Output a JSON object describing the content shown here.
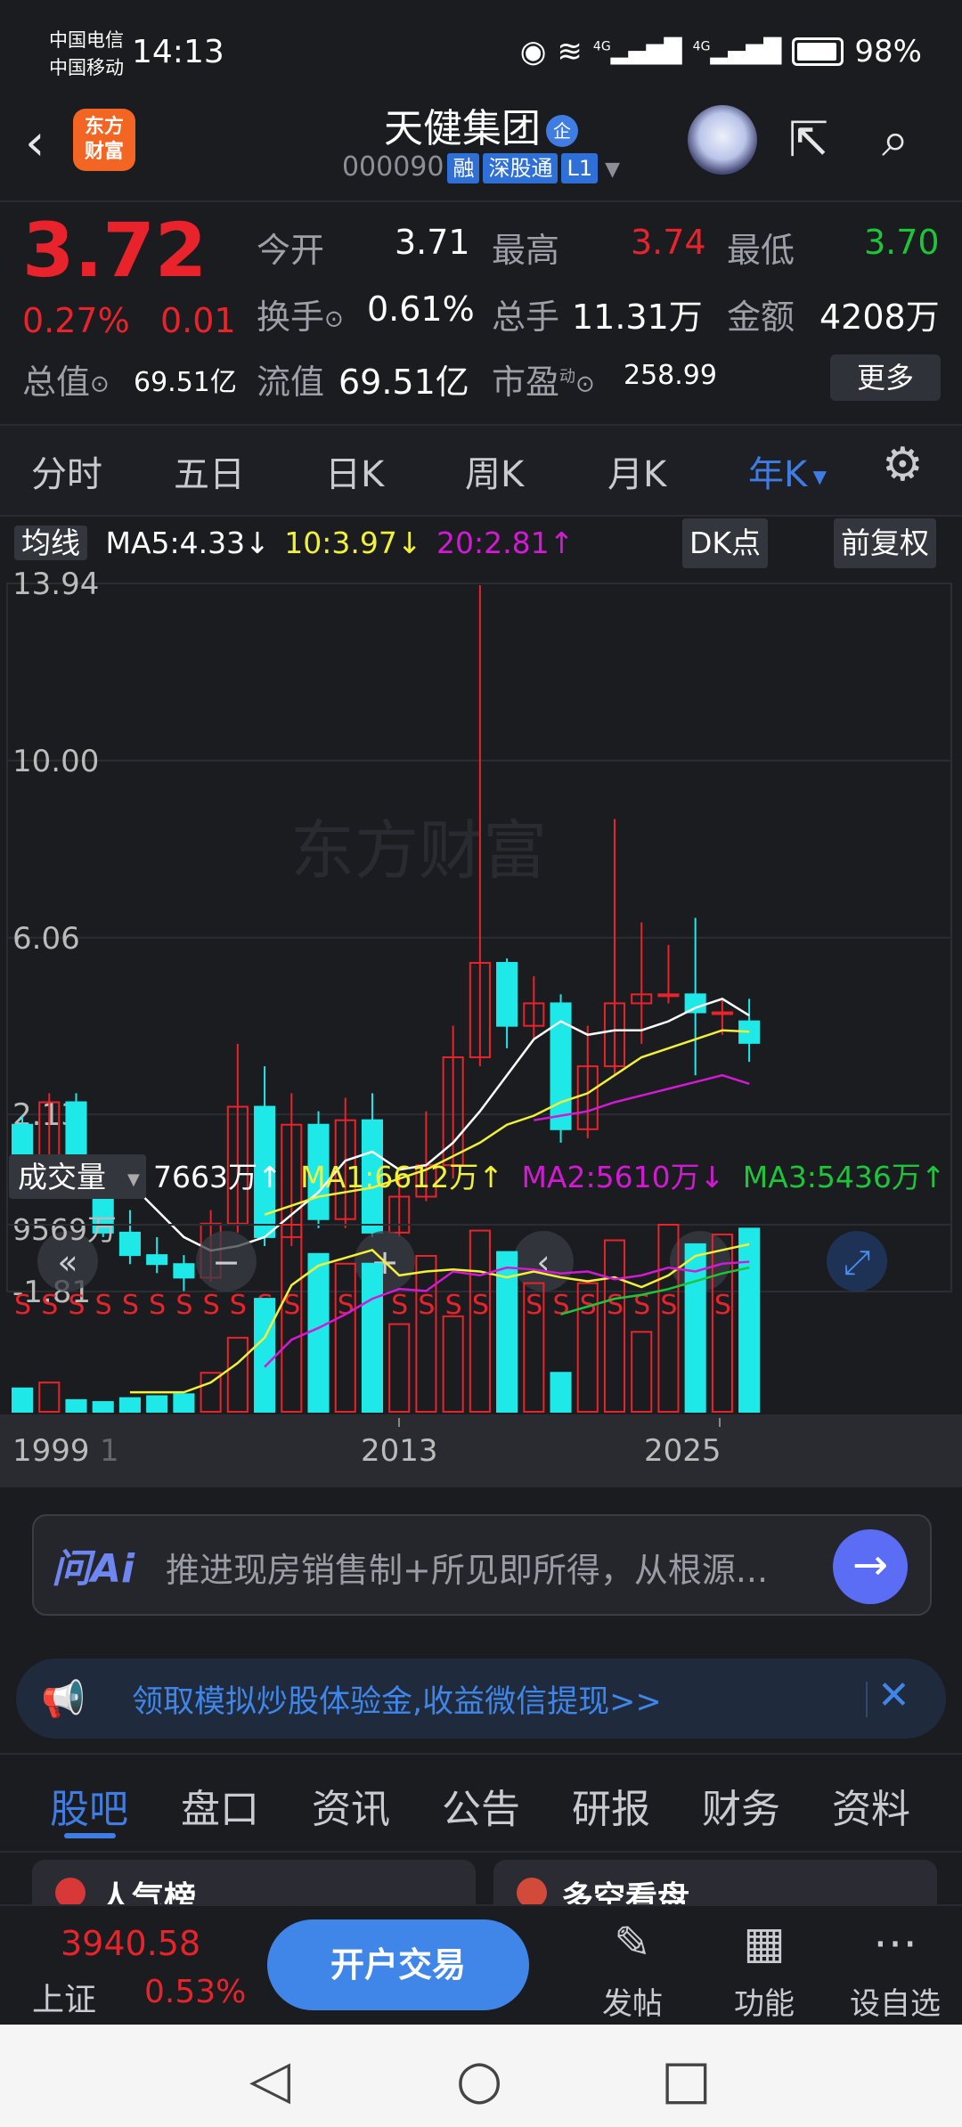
{
  "status_bar": {
    "carrier1": "中国电信",
    "carrier2": "中国移动",
    "time": "14:13",
    "battery": "98%",
    "net1": "4G",
    "net2": "4G"
  },
  "header": {
    "back": "‹",
    "logo_line1": "东方",
    "logo_line2": "财富",
    "title": "天健集团",
    "title_badge": "企",
    "code": "000090",
    "tag1": "融",
    "tag2": "深股通",
    "tag3": "L1"
  },
  "quote": {
    "price": "3.72",
    "pct": "0.27%",
    "chg": "0.01",
    "open_label": "今开",
    "open": "3.71",
    "high_label": "最高",
    "high": "3.74",
    "low_label": "最低",
    "low": "3.70",
    "turnover_label": "换手",
    "turnover": "0.61%",
    "volume_label": "总手",
    "volume": "11.31万",
    "amount_label": "金额",
    "amount": "4208万",
    "mcap_label": "总值",
    "mcap": "69.51亿",
    "float_label": "流值",
    "float": "69.51亿",
    "pe_label": "市盈",
    "pe_sup": "动",
    "pe": "258.99",
    "more": "更多"
  },
  "period_tabs": [
    "分时",
    "五日",
    "日K",
    "周K",
    "月K",
    "年K"
  ],
  "active_period": "年K",
  "ma_line": {
    "label": "均线",
    "ma5": "MA5:4.33",
    "ma5_dir": "↓",
    "ma10": "10:3.97",
    "ma10_dir": "↓",
    "ma20": "20:2.81",
    "ma20_dir": "↑",
    "dk": "DK点",
    "adj": "前复权"
  },
  "vol_line": {
    "label": "成交量",
    "vol": "7663万",
    "vol_dir": "↑",
    "ma1": "MA1:6612万",
    "ma1_dir": "↑",
    "ma2": "MA2:5610万",
    "ma2_dir": "↓",
    "ma3": "MA3:5436万",
    "ma3_dir": "↑"
  },
  "chart_data": {
    "type": "candlestick",
    "y_ticks": [
      "13.94",
      "10.00",
      "6.06",
      "2.13",
      "-1.81"
    ],
    "ylim": [
      -1.81,
      13.94
    ],
    "vol_tick": "9569万",
    "x_labels": [
      "1999",
      "1",
      "2013",
      "2025"
    ],
    "watermark": "东方财富",
    "marker": "S",
    "colors": {
      "up": "#e8232b",
      "down": "#1ee8e8",
      "ma5": "#ffffff",
      "ma10": "#f1f13a",
      "ma20": "#d21ad2",
      "ma3": "#1ec43a"
    },
    "candles": [
      {
        "o": 1.9,
        "c": 1.1,
        "h": 2.1,
        "l": 1.0,
        "v": 1200
      },
      {
        "o": 1.0,
        "c": 2.4,
        "h": 2.6,
        "l": 0.9,
        "v": 1500
      },
      {
        "o": 2.4,
        "c": 0.8,
        "h": 2.6,
        "l": 0.6,
        "v": 600
      },
      {
        "o": 0.8,
        "c": -0.5,
        "h": 0.9,
        "l": -0.6,
        "v": 500
      },
      {
        "o": -0.5,
        "c": -1.0,
        "h": 0.0,
        "l": -1.2,
        "v": 700
      },
      {
        "o": -1.0,
        "c": -1.2,
        "h": -0.6,
        "l": -1.4,
        "v": 800
      },
      {
        "o": -1.2,
        "c": -1.5,
        "h": -1.0,
        "l": -1.8,
        "v": 900
      },
      {
        "o": -1.5,
        "c": -0.3,
        "h": 0.0,
        "l": -1.6,
        "v": 2000
      },
      {
        "o": -0.3,
        "c": 2.3,
        "h": 3.7,
        "l": -0.5,
        "v": 3800
      },
      {
        "o": 2.3,
        "c": -0.6,
        "h": 3.2,
        "l": -0.8,
        "v": 5800
      },
      {
        "o": -0.6,
        "c": 1.9,
        "h": 2.6,
        "l": -0.8,
        "v": 9600
      },
      {
        "o": 1.9,
        "c": -0.2,
        "h": 2.2,
        "l": -0.4,
        "v": 8100
      },
      {
        "o": -0.2,
        "c": 2.0,
        "h": 2.5,
        "l": -0.4,
        "v": 7600
      },
      {
        "o": 2.0,
        "c": -0.5,
        "h": 2.6,
        "l": -0.6,
        "v": 7600
      },
      {
        "o": -0.5,
        "c": 0.3,
        "h": 0.8,
        "l": -0.6,
        "v": 4500
      },
      {
        "o": 0.3,
        "c": 1.0,
        "h": 2.2,
        "l": 0.2,
        "v": 8000
      },
      {
        "o": 1.0,
        "c": 3.4,
        "h": 4.1,
        "l": 0.7,
        "v": 4900
      },
      {
        "o": 3.4,
        "c": 5.5,
        "h": 13.9,
        "l": 3.2,
        "v": 9300
      },
      {
        "o": 5.5,
        "c": 4.1,
        "h": 5.6,
        "l": 3.6,
        "v": 8200
      },
      {
        "o": 4.1,
        "c": 4.6,
        "h": 5.2,
        "l": 3.8,
        "v": 6600
      },
      {
        "o": 4.6,
        "c": 1.8,
        "h": 4.8,
        "l": 1.5,
        "v": 2000
      },
      {
        "o": 1.8,
        "c": 3.2,
        "h": 4.1,
        "l": 1.6,
        "v": 6600
      },
      {
        "o": 3.2,
        "c": 4.6,
        "h": 8.7,
        "l": 3.0,
        "v": 8800
      },
      {
        "o": 4.6,
        "c": 4.8,
        "h": 6.4,
        "l": 3.7,
        "v": 4100
      },
      {
        "o": 4.8,
        "c": 4.8,
        "h": 5.9,
        "l": 4.6,
        "v": 9600
      },
      {
        "o": 4.8,
        "c": 4.4,
        "h": 6.5,
        "l": 3.0,
        "v": 8600
      },
      {
        "o": 4.4,
        "c": 4.4,
        "h": 4.7,
        "l": 3.9,
        "v": 9100
      },
      {
        "o": 4.2,
        "c": 3.72,
        "h": 4.7,
        "l": 3.3,
        "v": 9400
      }
    ],
    "ma5": [
      null,
      null,
      null,
      null,
      0.6,
      0.0,
      -0.6,
      -0.9,
      -0.8,
      -0.6,
      -0.1,
      0.4,
      1.1,
      1.3,
      0.9,
      1.0,
      1.5,
      2.2,
      3.0,
      3.8,
      4.2,
      3.9,
      4.0,
      4.0,
      4.2,
      4.5,
      4.7,
      4.33
    ],
    "ma10": [
      null,
      null,
      null,
      null,
      null,
      null,
      null,
      null,
      null,
      -0.1,
      0.1,
      0.3,
      0.4,
      0.5,
      0.7,
      0.9,
      1.2,
      1.5,
      1.9,
      2.1,
      2.4,
      2.6,
      3.0,
      3.4,
      3.6,
      3.8,
      4.0,
      3.97
    ],
    "ma20": [
      null,
      null,
      null,
      null,
      null,
      null,
      null,
      null,
      null,
      null,
      null,
      null,
      null,
      null,
      null,
      null,
      null,
      null,
      null,
      2.0,
      2.1,
      2.2,
      2.4,
      2.55,
      2.7,
      2.85,
      3.0,
      2.81
    ],
    "vol_ma1": [
      null,
      null,
      null,
      null,
      null,
      null,
      null,
      null,
      null,
      null,
      null,
      null,
      null,
      null,
      null,
      null,
      null,
      null,
      null,
      null,
      null,
      null,
      null,
      null,
      null,
      null,
      null,
      null
    ],
    "vol_ma1_line": [
      null,
      null,
      null,
      null,
      1000,
      1000,
      1000,
      1500,
      2500,
      3800,
      6500,
      7500,
      7900,
      8300,
      7000,
      7200,
      7300,
      7200,
      6900,
      7200,
      6900,
      6700,
      6900,
      6400,
      7000,
      8000,
      8300,
      8600
    ],
    "vol_ma2_line": [
      null,
      null,
      null,
      null,
      null,
      null,
      null,
      null,
      null,
      2300,
      3700,
      4300,
      5000,
      5800,
      6300,
      6200,
      7200,
      7000,
      7400,
      7300,
      7100,
      7200,
      6800,
      7000,
      7400,
      7200,
      7600,
      7700
    ],
    "vol_ma3_line": [
      null,
      null,
      null,
      null,
      null,
      null,
      null,
      null,
      null,
      null,
      null,
      null,
      null,
      null,
      null,
      null,
      null,
      null,
      null,
      null,
      5000,
      5400,
      5800,
      6000,
      6300,
      6700,
      7100,
      7400
    ]
  },
  "chart_buttons": {
    "prev": "«",
    "minus": "−",
    "plus": "+",
    "left": "‹",
    "right": "›",
    "expand": "⤢"
  },
  "ai": {
    "logo": "问Ai",
    "text": "推进现房销售制+所见即所得，从根源...",
    "go": "→"
  },
  "banner": {
    "text": "领取模拟炒股体验金,收益微信提现>>",
    "close": "✕"
  },
  "bottom_tabs": [
    "股吧",
    "盘口",
    "资讯",
    "公告",
    "研报",
    "财务",
    "资料"
  ],
  "cards": [
    "人气榜",
    "多空看盘"
  ],
  "index": {
    "value": "3940.58",
    "name": "上证",
    "pct": "0.53%"
  },
  "open_account": "开户交易",
  "actions": [
    {
      "icon": "✎",
      "label": "发帖"
    },
    {
      "icon": "▦",
      "label": "功能"
    },
    {
      "icon": "⋯",
      "label": "设自选"
    }
  ],
  "nav": {
    "back": "◁",
    "home": "○",
    "recent": "□"
  }
}
